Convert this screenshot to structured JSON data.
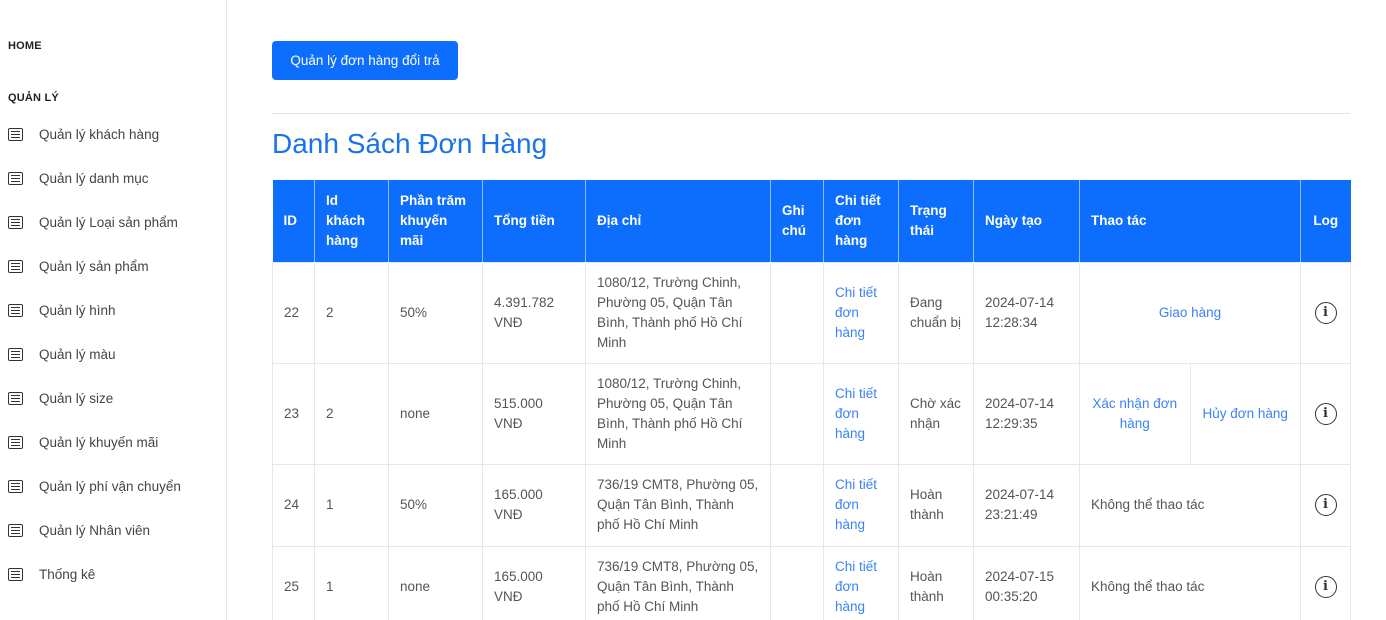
{
  "sidebar": {
    "home": "HOME",
    "section": "QUẢN LÝ",
    "items": [
      {
        "label": "Quản lý khách hàng"
      },
      {
        "label": "Quản lý danh mục"
      },
      {
        "label": "Quản lý Loại sản phẩm"
      },
      {
        "label": "Quản lý sản phẩm"
      },
      {
        "label": "Quản lý hình"
      },
      {
        "label": "Quản lý màu"
      },
      {
        "label": "Quản lý size"
      },
      {
        "label": "Quản lý khuyến mãi"
      },
      {
        "label": "Quản lý phí vận chuyển"
      },
      {
        "label": "Quản lý Nhân viên"
      },
      {
        "label": "Thống kê"
      }
    ],
    "item_icon": "list-icon"
  },
  "main": {
    "return_button": "Quản lý đơn hàng đổi trả",
    "title": "Danh Sách Đơn Hàng",
    "table": {
      "headers": {
        "id": "ID",
        "customer_id": "Id khách hàng",
        "discount": "Phần trăm khuyến mãi",
        "total": "Tổng tiền",
        "address": "Địa chỉ",
        "note": "Ghi chú",
        "detail": "Chi tiết đơn hàng",
        "status": "Trạng thái",
        "created": "Ngày tạo",
        "actions": "Thao tác",
        "log": "Log"
      },
      "rows": [
        {
          "id": "22",
          "customer_id": "2",
          "discount": "50%",
          "total": "4.391.782 VNĐ",
          "address": "1080/12, Trường Chinh, Phường 05, Quận Tân Bình, Thành phố Hồ Chí Minh",
          "note": "",
          "detail": "Chi tiết đơn hàng",
          "status": "Đang chuẩn bị",
          "created": "2024-07-14 12:28:34",
          "action1": "Giao hàng"
        },
        {
          "id": "23",
          "customer_id": "2",
          "discount": "none",
          "total": "515.000 VNĐ",
          "address": "1080/12, Trường Chinh, Phường 05, Quận Tân Bình, Thành phố Hồ Chí Minh",
          "note": "",
          "detail": "Chi tiết đơn hàng",
          "status": "Chờ xác nhận",
          "created": "2024-07-14 12:29:35",
          "action1": "Xác nhận đơn hàng",
          "action2": "Hủy đơn hàng"
        },
        {
          "id": "24",
          "customer_id": "1",
          "discount": "50%",
          "total": "165.000 VNĐ",
          "address": "736/19 CMT8, Phường 05, Quận Tân Bình, Thành phố Hồ Chí Minh",
          "note": "",
          "detail": "Chi tiết đơn hàng",
          "status": "Hoàn thành",
          "created": "2024-07-14 23:21:49",
          "action_text": "Không thể thao tác"
        },
        {
          "id": "25",
          "customer_id": "1",
          "discount": "none",
          "total": "165.000 VNĐ",
          "address": "736/19 CMT8, Phường 05, Quận Tân Bình, Thành phố Hồ Chí Minh",
          "note": "",
          "detail": "Chi tiết đơn hàng",
          "status": "Hoàn thành",
          "created": "2024-07-15 00:35:20",
          "action_text": "Không thể thao tác"
        }
      ],
      "log_icon": "info-icon",
      "log_glyph": "i"
    }
  },
  "colors": {
    "primary": "#0d6efd",
    "title": "#1a73e8",
    "link": "#3b82f6"
  }
}
